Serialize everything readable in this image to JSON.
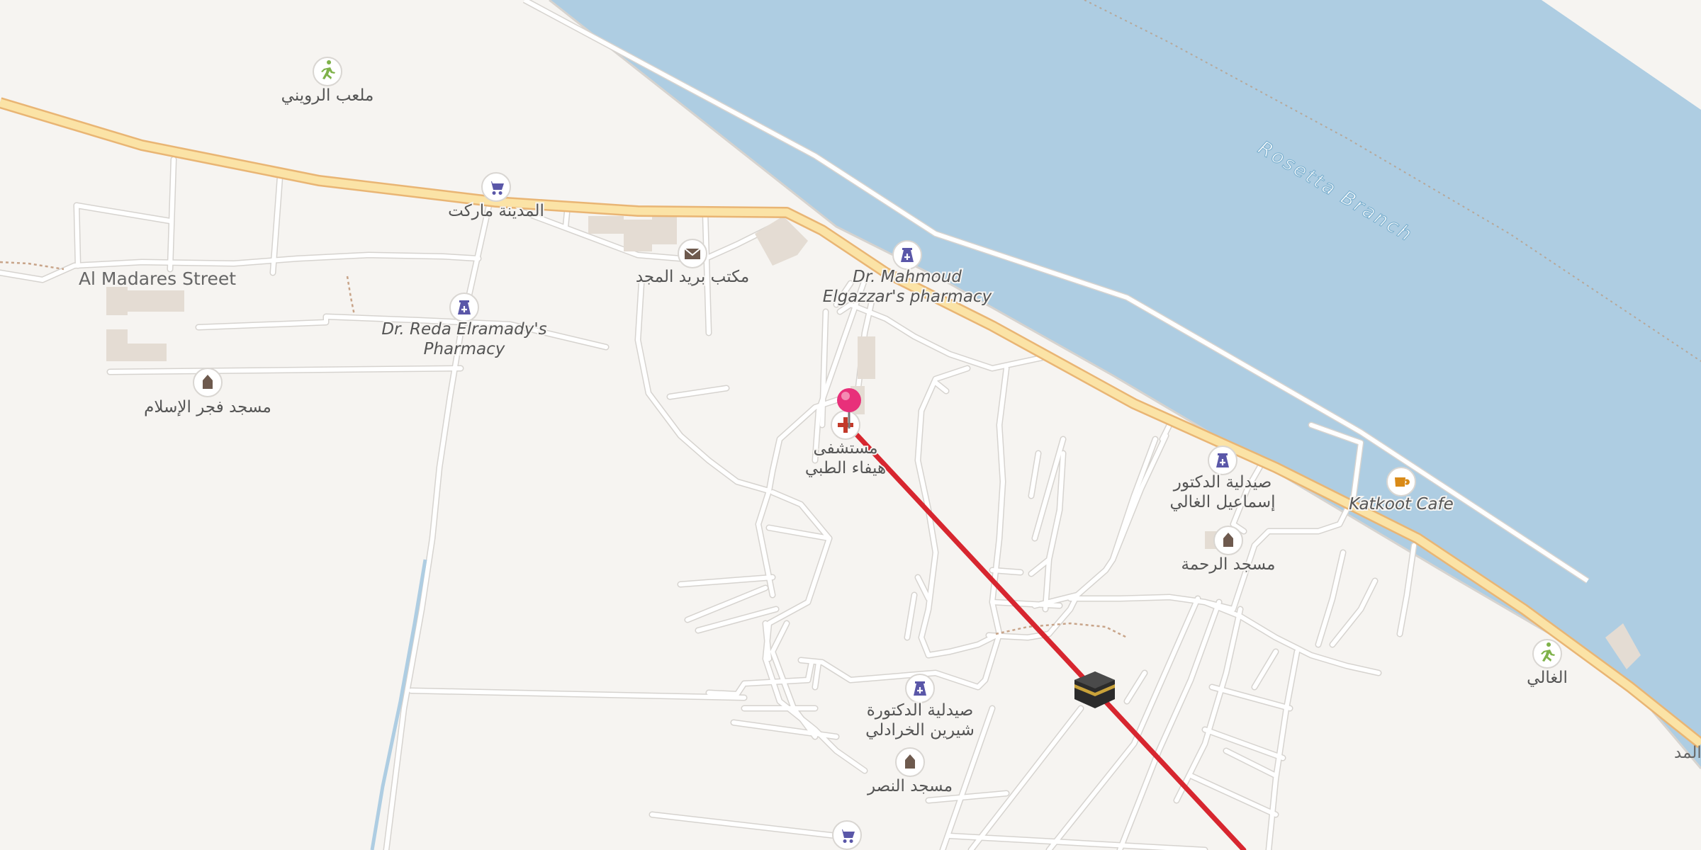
{
  "map": {
    "water_label": "Rosetta Branch",
    "street_label": "Al Madares Street",
    "edge_label": "المد",
    "colors": {
      "water": "#aecde2",
      "land": "#f6f4f1",
      "primary_road": "#fbe3a6",
      "primary_road_casing": "#e9b574",
      "minor_road": "#ffffff",
      "minor_road_casing": "#d6d3cf",
      "route_line": "#d7262f",
      "pin": "#e8307a",
      "icon_blue": "#5a57a8",
      "icon_green": "#7fb24a",
      "icon_brown": "#6e5a4e",
      "icon_red": "#c33a2a",
      "icon_orange": "#d98a17",
      "water_label_color": "#7fb2d0"
    },
    "pois": [
      {
        "id": "stadium-1",
        "icon": "sports-icon",
        "label": [
          "ملعب الرويني"
        ],
        "italic": false
      },
      {
        "id": "market",
        "icon": "shopping-cart-icon",
        "label": [
          "المدينة ماركت"
        ],
        "italic": false
      },
      {
        "id": "post-office",
        "icon": "mail-icon",
        "label": [
          "مكتب بريد المجد"
        ],
        "italic": false
      },
      {
        "id": "pharmacy-mahmoud",
        "icon": "pharmacy-icon",
        "label": [
          "Dr. Mahmoud",
          "Elgazzar's pharmacy"
        ],
        "italic": true
      },
      {
        "id": "pharmacy-reda",
        "icon": "pharmacy-icon",
        "label": [
          "Dr. Reda Elramady's",
          "Pharmacy"
        ],
        "italic": true
      },
      {
        "id": "mosque-fajr",
        "icon": "mosque-icon",
        "label": [
          "مسجد فجر الإسلام"
        ],
        "italic": false
      },
      {
        "id": "hospital",
        "icon": "hospital-icon",
        "label": [
          "مستشفى",
          "هيفاء الطبي"
        ],
        "italic": false
      },
      {
        "id": "pharmacy-ismail",
        "icon": "pharmacy-icon",
        "label": [
          "صيدلية الدكتور",
          "إسماعيل الغالي"
        ],
        "italic": false
      },
      {
        "id": "cafe",
        "icon": "cafe-icon",
        "label": [
          "Katkoot Cafe"
        ],
        "italic": true
      },
      {
        "id": "mosque-rahma",
        "icon": "mosque-icon",
        "label": [
          "مسجد الرحمة"
        ],
        "italic": false
      },
      {
        "id": "pharmacy-shereen",
        "icon": "pharmacy-icon",
        "label": [
          "صيدلية الدكتورة",
          "شيرين الخرادلي"
        ],
        "italic": false
      },
      {
        "id": "mosque-nasr",
        "icon": "mosque-icon",
        "label": [
          "مسجد النصر"
        ],
        "italic": false
      },
      {
        "id": "stadium-2",
        "icon": "sports-icon",
        "label": [
          "الغالي"
        ],
        "italic": false
      },
      {
        "id": "market-2",
        "icon": "shopping-cart-icon",
        "label": [],
        "italic": false
      }
    ],
    "markers": {
      "pin": "location-pin-icon",
      "kaaba": "kaaba-icon"
    }
  }
}
